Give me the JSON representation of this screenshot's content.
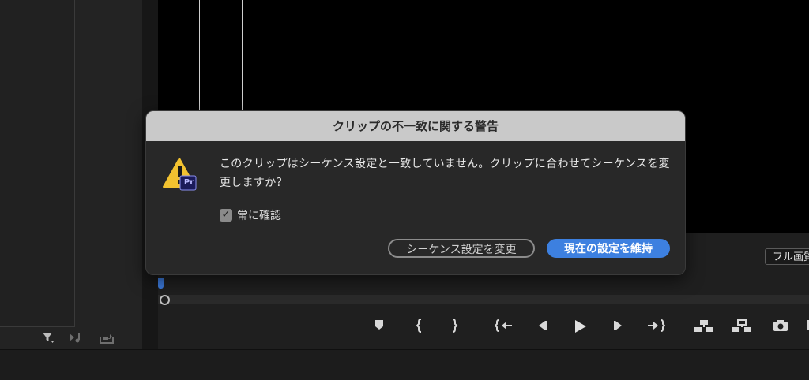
{
  "dialog": {
    "title": "クリップの不一致に関する警告",
    "message": "このクリップはシーケンス設定と一致していません。クリップに合わせてシーケンスを変更しますか？",
    "checkbox_label": "常に確認",
    "checkbox_checked": true,
    "icon_badge": "Pr",
    "buttons": {
      "change_sequence": "シーケンス設定を変更",
      "keep_settings": "現在の設定を維持"
    }
  },
  "monitor": {
    "fit_dropdown": "フル画質"
  },
  "colors": {
    "accent": "#3d80e0",
    "warning": "#f2c230",
    "badge": "#1b1b5a",
    "dialog_bg": "#282828",
    "titlebar_bg": "#c9c9c9"
  },
  "icons": {
    "left_toolbar": [
      "filter-icon",
      "audio-only-icon",
      "export-icon"
    ],
    "transport": [
      "marker-icon",
      "mark-in-icon",
      "mark-out-icon",
      "go-to-in-icon",
      "step-back-icon",
      "play-icon",
      "step-forward-icon",
      "go-to-out-icon",
      "insert-icon",
      "overwrite-icon",
      "export-frame-icon"
    ]
  }
}
